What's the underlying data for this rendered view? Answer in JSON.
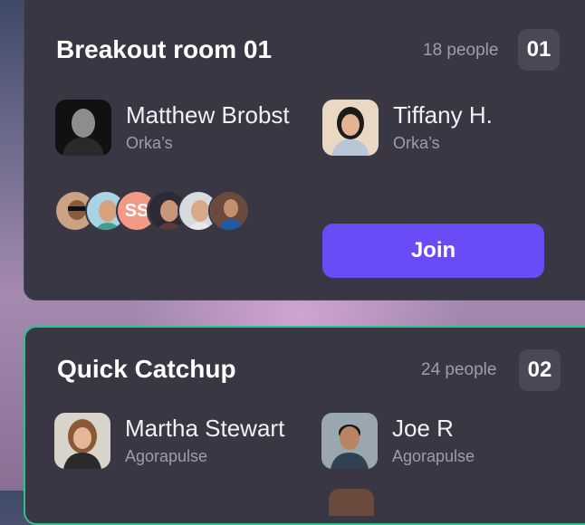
{
  "rooms": [
    {
      "title": "Breakout room 01",
      "people": "18 people",
      "number": "01",
      "members": [
        {
          "name": "Matthew Brobst",
          "org": "Orka’s"
        },
        {
          "name": "Tiffany H.",
          "org": "Orka’s"
        }
      ],
      "stack_initials": "SS",
      "join_label": "Join"
    },
    {
      "title": "Quick Catchup",
      "people": "24 people",
      "number": "02",
      "members": [
        {
          "name": "Martha Stewart",
          "org": "Agorapulse"
        },
        {
          "name": "Joe R",
          "org": "Agorapulse"
        }
      ]
    }
  ],
  "colors": {
    "card_bg": "#3a3745",
    "accent_button": "#6a4cf6",
    "active_border": "#2fbf8a",
    "muted_text": "#9f9cab"
  },
  "icons": [
    "avatar-photo",
    "avatar-stack"
  ]
}
